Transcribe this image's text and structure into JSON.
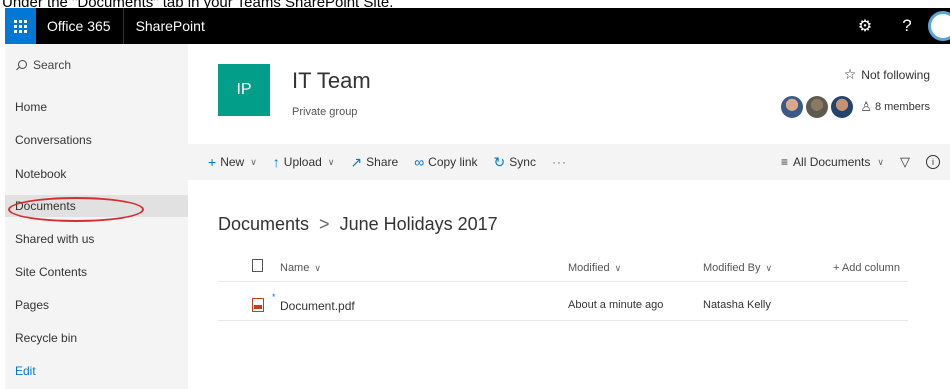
{
  "caption": "Under the \"Documents\" tab in your Teams SharePoint Site.",
  "topbar": {
    "brand": "Office 365",
    "app": "SharePoint",
    "icons": [
      "waffle-icon",
      "gear-icon",
      "help-icon",
      "avatar"
    ],
    "settings_glyph": "⚙",
    "help_glyph": "?"
  },
  "sidebar": {
    "search_label": "Search",
    "items": [
      {
        "label": "Home"
      },
      {
        "label": "Conversations"
      },
      {
        "label": "Notebook"
      },
      {
        "label": "Documents",
        "active": true
      },
      {
        "label": "Shared with us"
      },
      {
        "label": "Site Contents"
      },
      {
        "label": "Pages"
      },
      {
        "label": "Recycle bin"
      }
    ],
    "edit_label": "Edit"
  },
  "site": {
    "logo_text": "IP",
    "title": "IT Team",
    "subtitle": "Private group",
    "follow_label": "Not following",
    "members_label": "8 members"
  },
  "commandbar": {
    "new": "New",
    "upload": "Upload",
    "share": "Share",
    "copy_link": "Copy link",
    "sync": "Sync",
    "more": "···",
    "view": "All Documents"
  },
  "breadcrumb": {
    "root": "Documents",
    "separator": ">",
    "current": "June Holidays 2017"
  },
  "list": {
    "columns": {
      "name": "Name",
      "modified": "Modified",
      "modified_by": "Modified By",
      "add_column": "+ Add column"
    },
    "rows": [
      {
        "name": "Document.pdf",
        "modified": "About a minute ago",
        "modified_by": "Natasha Kelly"
      }
    ]
  },
  "colors": {
    "accent": "#0078d4",
    "site_logo": "#039e8a",
    "annotation": "#d32f2f"
  }
}
